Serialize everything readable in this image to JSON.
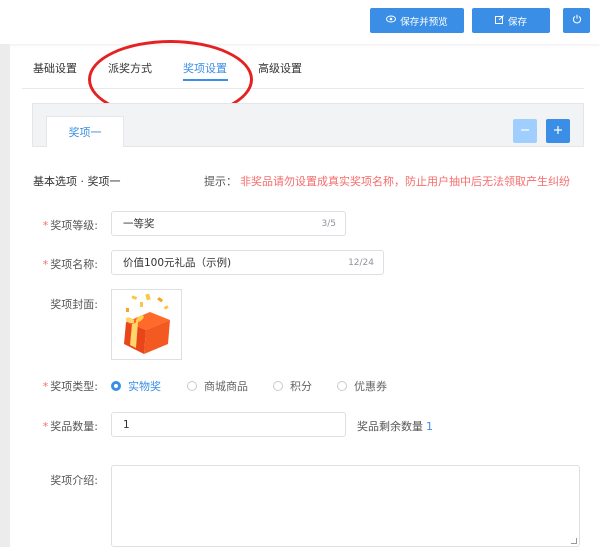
{
  "toolbar": {
    "save_preview_label": "保存并预览",
    "save_label": "保存",
    "accent_color": "#3a8ee6"
  },
  "tabs": [
    {
      "label": "基础设置"
    },
    {
      "label": "派奖方式"
    },
    {
      "label": "奖项设置"
    },
    {
      "label": "高级设置"
    }
  ],
  "prize_tabs": {
    "active_label": "奖项一"
  },
  "section": {
    "title": "基本选项 · 奖项一",
    "tip_label": "提示：",
    "tip_text": "非奖品请勿设置成真实奖项名称，防止用户抽中后无法领取产生纠纷",
    "tip_color": "#f56c6c"
  },
  "form": {
    "level": {
      "label": "奖项等级:",
      "value": "一等奖",
      "counter": "3/5"
    },
    "name": {
      "label": "奖项名称:",
      "value": "价值100元礼品（示例)",
      "counter": "12/24"
    },
    "cover": {
      "label": "奖项封面:"
    },
    "type": {
      "label": "奖项类型:",
      "options": [
        {
          "label": "实物奖",
          "selected": true
        },
        {
          "label": "商城商品",
          "selected": false
        },
        {
          "label": "积分",
          "selected": false
        },
        {
          "label": "优惠券",
          "selected": false
        }
      ]
    },
    "quantity": {
      "label": "奖品数量:",
      "value": "1",
      "remain_label": "奖品剩余数量",
      "remain_value": "1"
    },
    "intro": {
      "label": "奖项介绍:",
      "value": ""
    }
  }
}
